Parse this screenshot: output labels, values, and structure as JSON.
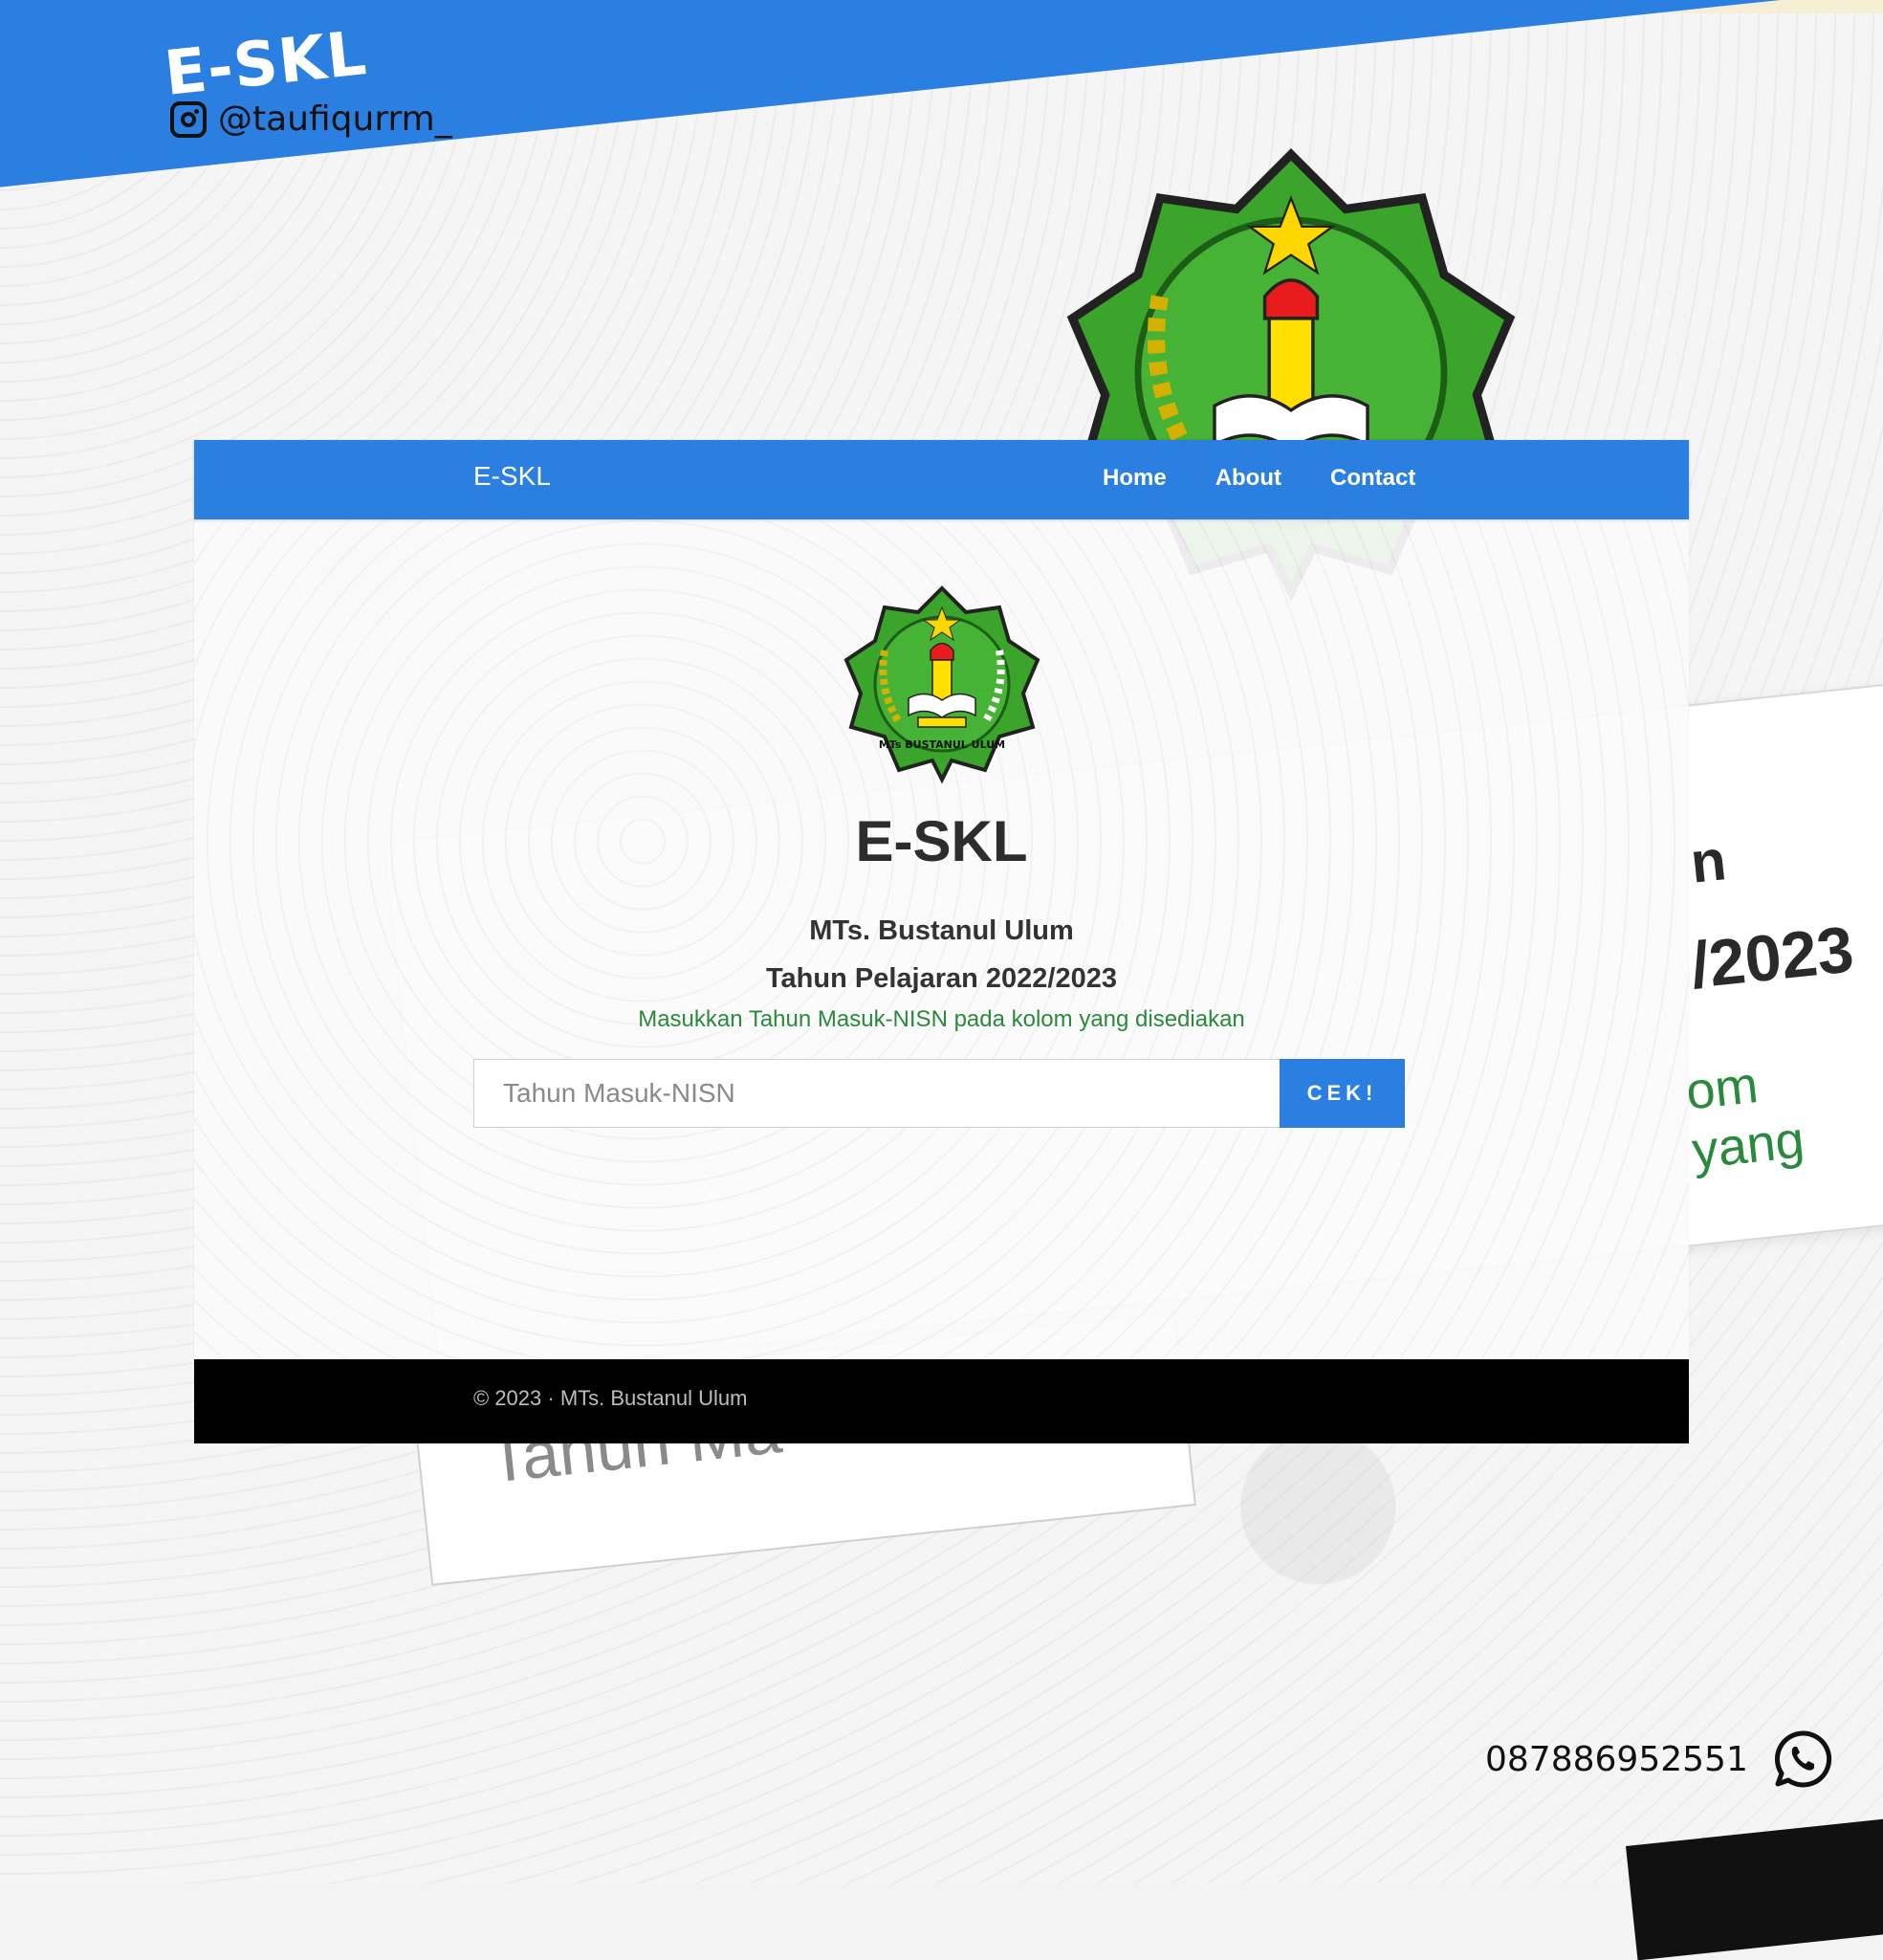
{
  "background": {
    "header_title": "E-SKL",
    "instagram_handle": "@taufiqurrm_",
    "fragment_line1": "n",
    "fragment_line2": "/2023",
    "fragment_line3": "om yang",
    "fragment_input": "Tahun Ma"
  },
  "navbar": {
    "brand": "E-SKL",
    "links": [
      "Home",
      "About",
      "Contact"
    ]
  },
  "main": {
    "title": "E-SKL",
    "school": "MTs. Bustanul Ulum",
    "year": "Tahun Pelajaran 2022/2023",
    "hint": "Masukkan Tahun Masuk-NISN pada kolom yang disediakan",
    "search_placeholder": "Tahun Masuk-NISN",
    "search_value": "",
    "button_label": "CEK!"
  },
  "emblem": {
    "ring_text": "MTs BUSTANUL ULUM"
  },
  "footer": {
    "copyright": "© 2023 · MTs. Bustanul Ulum"
  },
  "contact": {
    "whatsapp_number": "087886952551"
  },
  "colors": {
    "primary": "#2b7fe0",
    "hint_green": "#2a8a3c",
    "footer": "#000000",
    "emblem_green": "#3aa52a"
  },
  "icons": [
    "instagram-icon",
    "whatsapp-icon",
    "school-emblem"
  ]
}
